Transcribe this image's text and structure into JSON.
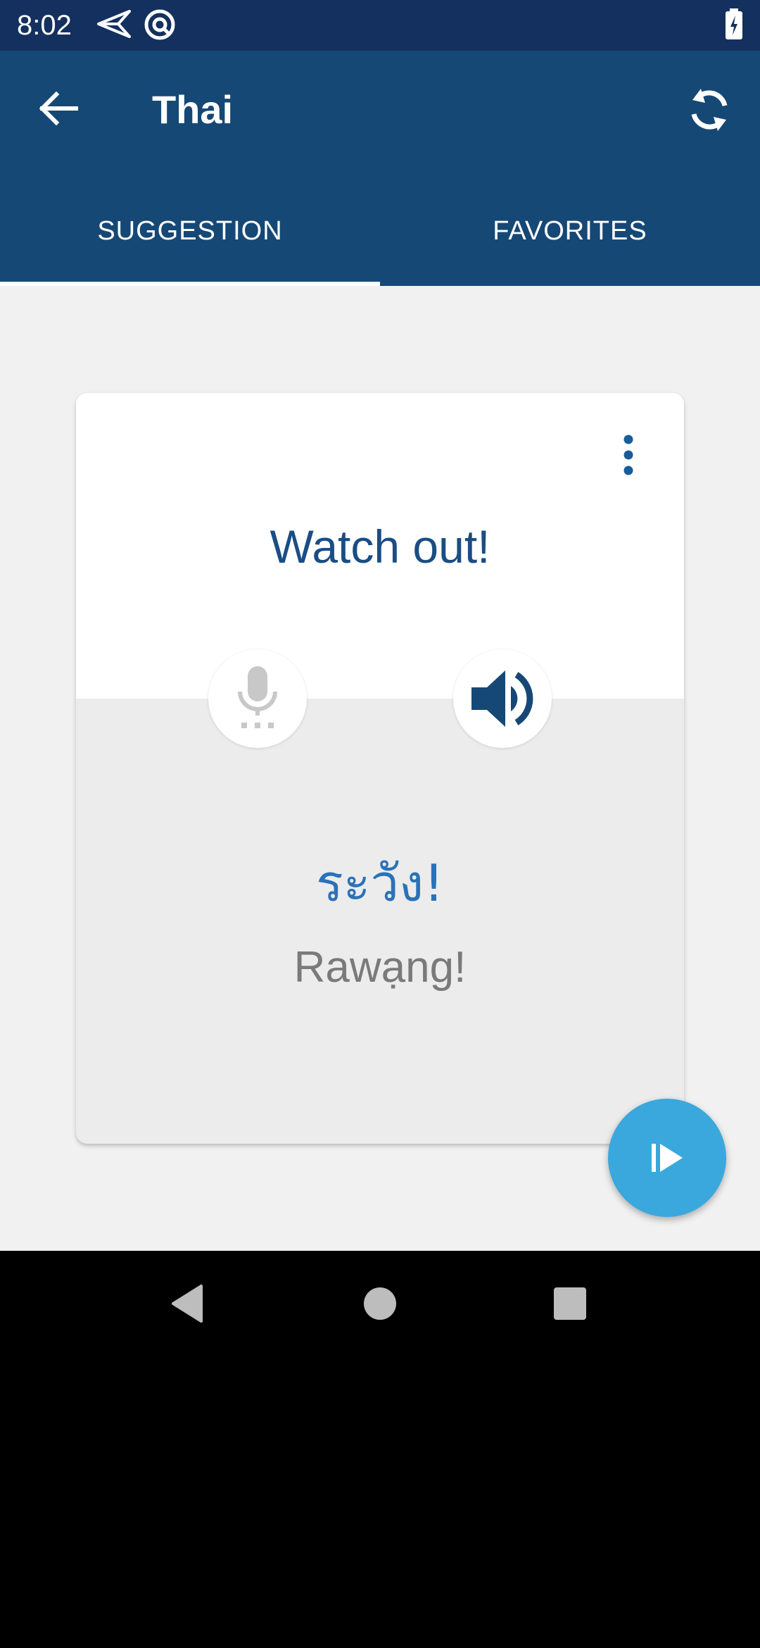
{
  "status_bar": {
    "time": "8:02",
    "icons": [
      "send-icon",
      "circle-a-icon",
      "battery-icon"
    ]
  },
  "app_bar": {
    "title": "Thai",
    "back_icon": "arrow-left-icon",
    "refresh_icon": "refresh-icon"
  },
  "tabs": [
    {
      "label": "SUGGESTION",
      "selected": true
    },
    {
      "label": "FAVORITES",
      "selected": false
    }
  ],
  "card": {
    "phrase": "Watch out!",
    "translation": "ระวัง!",
    "transliteration": "Rawạng!",
    "menu_icon": "more-vert-icon",
    "mic_icon": "microphone-icon",
    "speaker_icon": "speaker-icon"
  },
  "fab": {
    "icon": "play-next-icon"
  },
  "nav_bar": {
    "icons": [
      "back-triangle-icon",
      "home-circle-icon",
      "recents-square-icon"
    ]
  },
  "colors": {
    "status_bar": "#14305e",
    "app_bar": "#164876",
    "phrase_text": "#1a4d84",
    "translation_text": "#2a72b8",
    "transliteration_text": "#7a7a7a",
    "fab": "#3aa8dd",
    "background": "#f1f1f1"
  }
}
